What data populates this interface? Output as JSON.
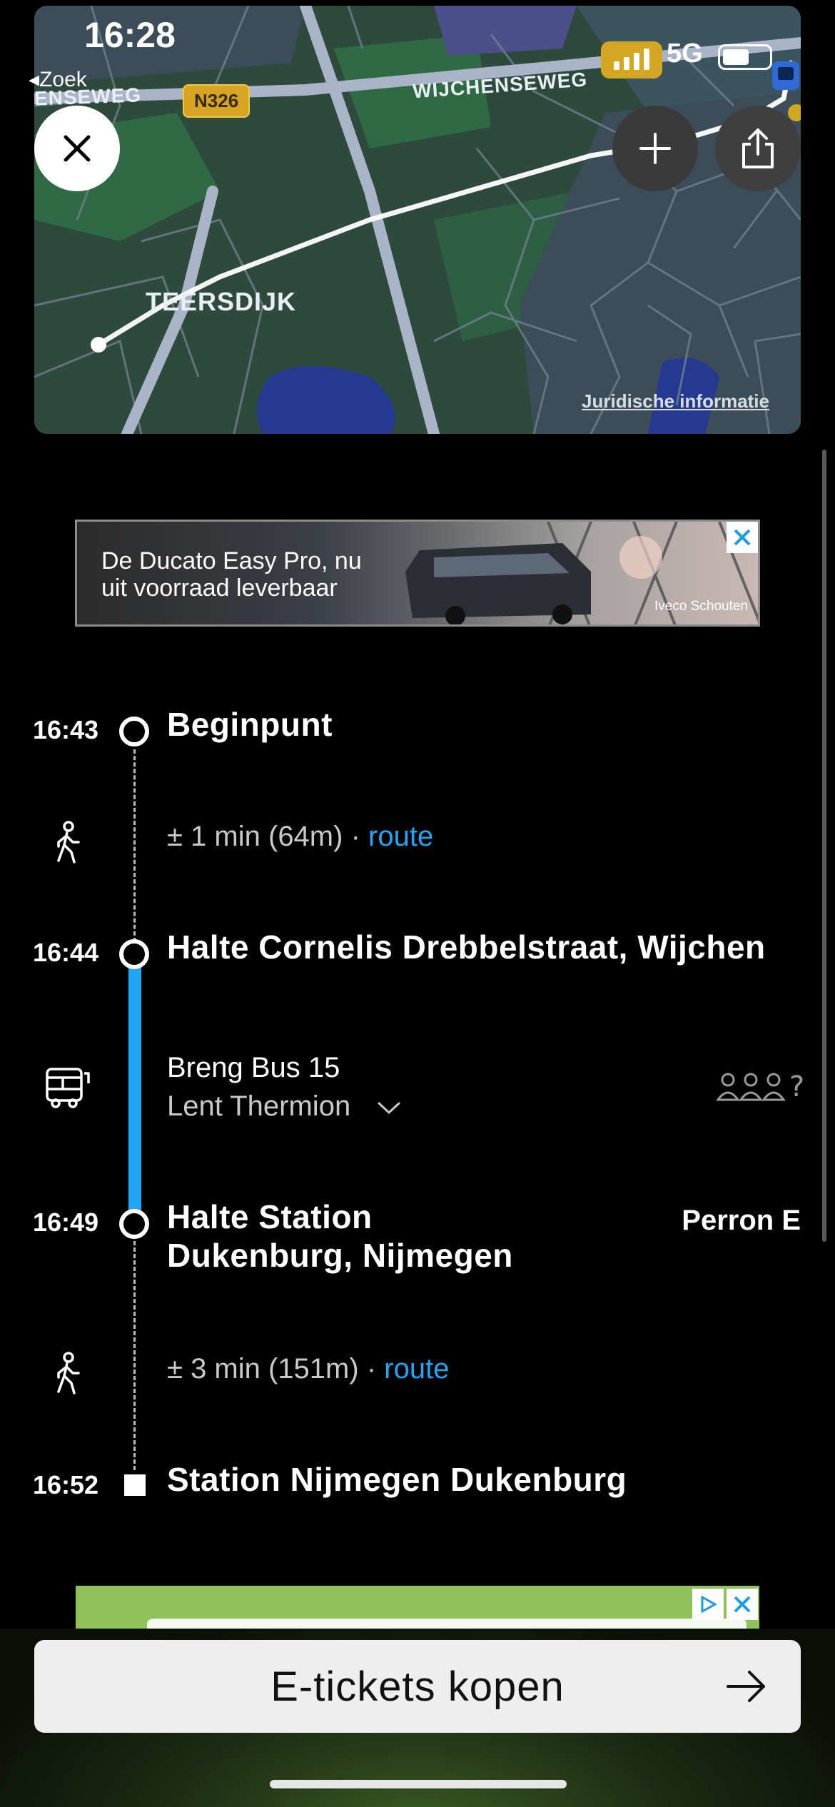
{
  "status_bar": {
    "time": "16:28",
    "back_label": "Zoek",
    "network": "5G"
  },
  "map": {
    "road_label_left": "ENSEWEG",
    "road_label_right": "WIJCHENSEWEG",
    "road_shield": "N326",
    "area_label": "TEERSDIJK",
    "legal_link": "Juridische informatie",
    "colors": {
      "land": "#2f4a3b",
      "route": "#ffffff",
      "water": "#24398f"
    }
  },
  "map_controls": {
    "close_icon": "close-icon",
    "add_icon": "plus-icon",
    "share_icon": "share-icon"
  },
  "ad_top": {
    "headline_line1": "De Ducato Easy Pro, nu",
    "headline_line2": "uit voorraad leverbaar",
    "brand": "Iveco Schouten"
  },
  "journey": {
    "accent_color": "#1fa7f5",
    "legs": [
      {
        "time": "16:43",
        "name": "Beginpunt"
      },
      {
        "walk": "± 1 min (64m)",
        "sep": "·",
        "link": "route"
      },
      {
        "time": "16:44",
        "name": "Halte Cornelis Drebbelstraat, Wijchen"
      },
      {
        "line": "Breng Bus 15",
        "destination": "Lent Thermion",
        "crowd": "?"
      },
      {
        "time": "16:49",
        "name_line1": "Halte Station",
        "name_line2": "Dukenburg, Nijmegen",
        "platform": "Perron E"
      },
      {
        "walk": "± 3 min (151m)",
        "sep": "·",
        "link": "route"
      },
      {
        "time": "16:52",
        "name": "Station Nijmegen Dukenburg"
      }
    ]
  },
  "bottom": {
    "cta_label": "E-tickets kopen"
  }
}
